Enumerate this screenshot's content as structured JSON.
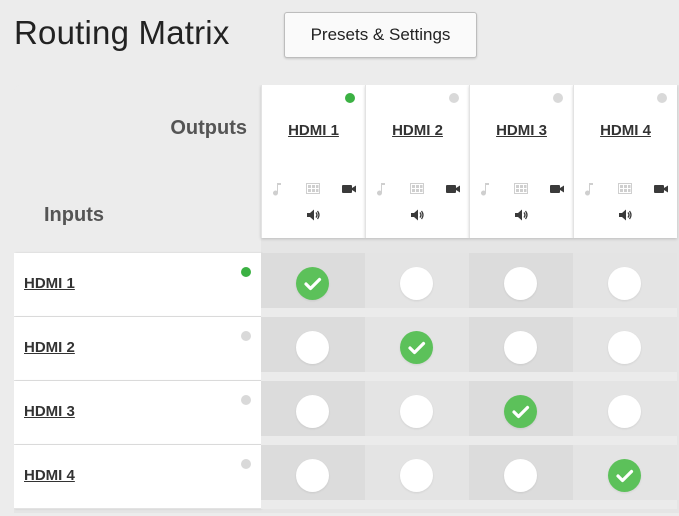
{
  "title": "Routing Matrix",
  "presets_button": "Presets & Settings",
  "labels": {
    "outputs": "Outputs",
    "inputs": "Inputs"
  },
  "outputs": [
    {
      "label": "HDMI 1",
      "status": "active"
    },
    {
      "label": "HDMI 2",
      "status": "inactive"
    },
    {
      "label": "HDMI 3",
      "status": "inactive"
    },
    {
      "label": "HDMI 4",
      "status": "inactive"
    }
  ],
  "inputs": [
    {
      "label": "HDMI 1",
      "status": "active"
    },
    {
      "label": "HDMI 2",
      "status": "inactive"
    },
    {
      "label": "HDMI 3",
      "status": "inactive"
    },
    {
      "label": "HDMI 4",
      "status": "inactive"
    }
  ],
  "routes": [
    [
      true,
      false,
      false,
      false
    ],
    [
      false,
      true,
      false,
      false
    ],
    [
      false,
      false,
      true,
      false
    ],
    [
      false,
      false,
      false,
      true
    ]
  ],
  "output_icons": [
    "music-note-icon",
    "grid-icon",
    "video-camera-icon",
    "speaker-icon"
  ],
  "colors": {
    "active_dot": "#3bb143",
    "inactive_dot": "#d9d9d9",
    "route_on": "#5cc15a",
    "route_off": "#ffffff"
  }
}
